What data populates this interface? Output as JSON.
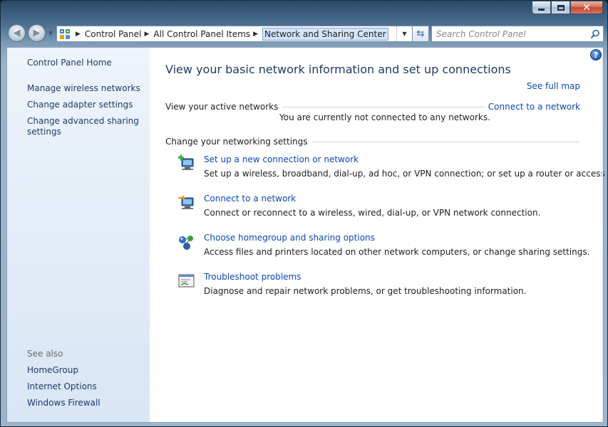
{
  "window": {
    "caption": {
      "minimize_icon": "minimize-icon",
      "maximize_icon": "maximize-icon",
      "close_label": "✕"
    }
  },
  "nav": {
    "back_icon": "back-arrow-icon",
    "forward_icon": "forward-arrow-icon",
    "breadcrumbs": [
      "Control Panel",
      "All Control Panel Items",
      "Network and Sharing Center"
    ],
    "search_placeholder": "Search Control Panel"
  },
  "sidebar": {
    "home": "Control Panel Home",
    "links": [
      "Manage wireless networks",
      "Change adapter settings",
      "Change advanced sharing settings"
    ],
    "see_also_label": "See also",
    "see_also": [
      "HomeGroup",
      "Internet Options",
      "Windows Firewall"
    ]
  },
  "main": {
    "title": "View your basic network information and set up connections",
    "see_full_map": "See full map",
    "active_networks_label": "View your active networks",
    "connect_to_network": "Connect to a network",
    "status_message": "You are currently not connected to any networks.",
    "settings_label": "Change your networking settings",
    "tasks": [
      {
        "icon": "new-connection-icon",
        "link": "Set up a new connection or network",
        "desc": "Set up a wireless, broadband, dial-up, ad hoc, or VPN connection; or set up a router or access point."
      },
      {
        "icon": "connect-network-icon",
        "link": "Connect to a network",
        "desc": "Connect or reconnect to a wireless, wired, dial-up, or VPN network connection."
      },
      {
        "icon": "homegroup-icon",
        "link": "Choose homegroup and sharing options",
        "desc": "Access files and printers located on other network computers, or change sharing settings."
      },
      {
        "icon": "troubleshoot-icon",
        "link": "Troubleshoot problems",
        "desc": "Diagnose and repair network problems, or get troubleshooting information."
      }
    ]
  },
  "colors": {
    "link": "#0d47b6",
    "sidebar_link": "#1e3a68",
    "title": "#1e395b",
    "sidebar_bg": "#e1ebf7"
  }
}
